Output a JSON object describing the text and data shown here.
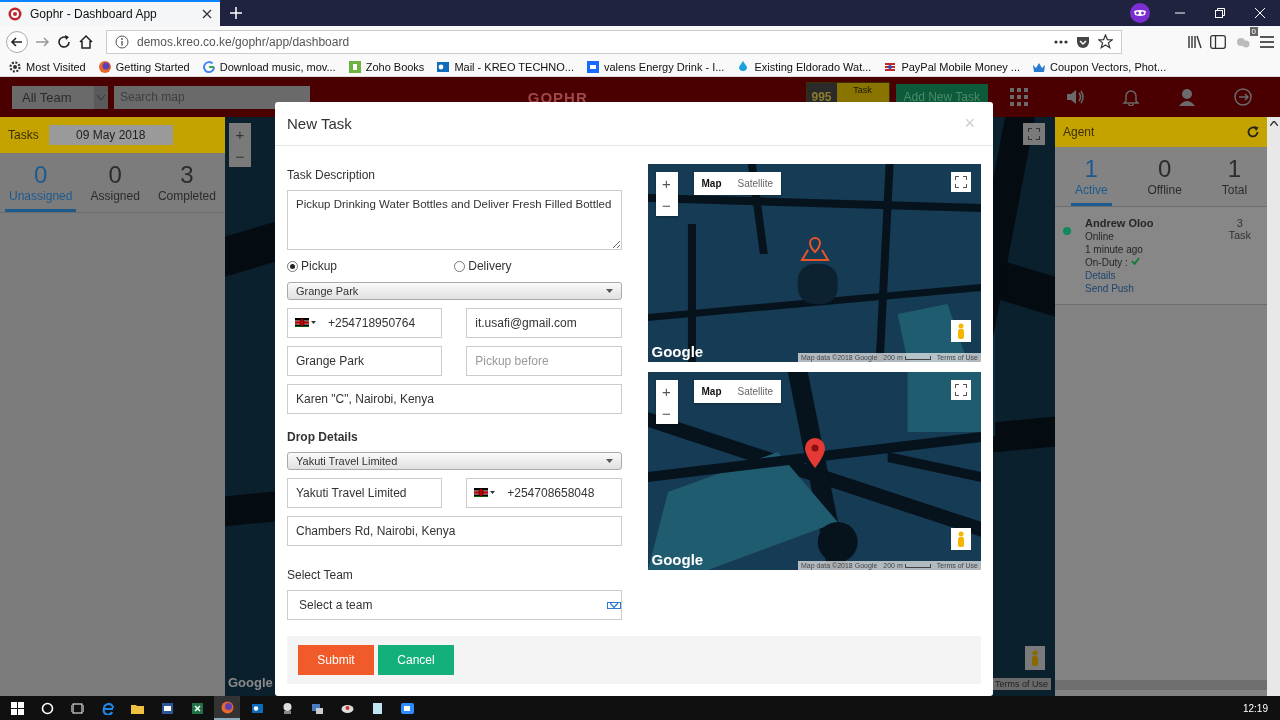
{
  "browser": {
    "tab_title": "Gophr - Dashboard App",
    "url": "demos.kreo.co.ke/gophr/app/dashboard",
    "extension_badge": "0",
    "bookmarks": [
      {
        "label": "Most Visited",
        "kind": "gear"
      },
      {
        "label": "Getting Started",
        "kind": "fox"
      },
      {
        "label": "Download music, mov...",
        "kind": "g"
      },
      {
        "label": "Zoho Books",
        "kind": "zoho"
      },
      {
        "label": "Mail - KREO TECHNO...",
        "kind": "mail"
      },
      {
        "label": "valens Energy Drink - I...",
        "kind": "be"
      },
      {
        "label": "Existing Eldorado Wat...",
        "kind": "drop"
      },
      {
        "label": "PayPal Mobile Money ...",
        "kind": "pay"
      },
      {
        "label": "Coupon Vectors, Phot...",
        "kind": "crown"
      }
    ]
  },
  "header": {
    "team_select": "All Team",
    "search_placeholder": "Search map",
    "logo": "GOPHR",
    "tasks_remaining": "995",
    "tasks_remaining_label": "Task",
    "add_button": "Add New Task"
  },
  "tasks_panel": {
    "title": "Tasks",
    "date": "09 May 2018",
    "tabs": [
      {
        "count": "0",
        "label": "Unassigned",
        "selected": true
      },
      {
        "count": "0",
        "label": "Assigned",
        "selected": false
      },
      {
        "count": "3",
        "label": "Completed",
        "selected": false
      }
    ]
  },
  "background_map": {
    "zoom_in": "+",
    "zoom_out": "−",
    "logo": "Google",
    "terms": "Terms of Use"
  },
  "agent_panel": {
    "title": "Agent",
    "tabs": [
      {
        "count": "1",
        "label": "Active",
        "selected": true
      },
      {
        "count": "0",
        "label": "Offline",
        "selected": false
      },
      {
        "count": "1",
        "label": "Total",
        "selected": false
      }
    ],
    "agents": [
      {
        "name": "Andrew Oloo",
        "status": "Online",
        "last_seen": "1 minute ago",
        "duty_label": "On-Duty :",
        "on_duty": true,
        "links": [
          "Details",
          "Send Push"
        ],
        "task_count": "3",
        "task_label": "Task",
        "color": "#0f8a5a"
      }
    ]
  },
  "modal": {
    "title": "New Task",
    "close": "×",
    "description_label": "Task Description",
    "description": "Pickup Drinking Water Bottles and Deliver Fresh Filled Bottled",
    "task_types": [
      {
        "label": "Pickup",
        "selected": true
      },
      {
        "label": "Delivery",
        "selected": false
      }
    ],
    "pickup_select": "Grange Park",
    "pickup_phone": "+254718950764",
    "pickup_email": "it.usafi@gmail.com",
    "pickup_name": "Grange Park",
    "pickup_before_placeholder": "Pickup before",
    "pickup_address": "Karen \"C\", Nairobi, Kenya",
    "drop_title": "Drop Details",
    "drop_select": "Yakuti Travel Limited",
    "drop_name": "Yakuti Travel Limited",
    "drop_phone": "+254708658048",
    "drop_address": "Chambers Rd, Nairobi, Kenya",
    "team_label": "Select Team",
    "team_select": "Select a team",
    "buttons": [
      {
        "label": "Submit",
        "kind": "submit"
      },
      {
        "label": "Cancel",
        "kind": "cancel"
      }
    ],
    "maps": [
      {
        "kind": "place",
        "zoom_in": "+",
        "zoom_out": "−",
        "map_types": [
          {
            "label": "Map",
            "selected": true
          },
          {
            "label": "Satellite",
            "selected": false
          }
        ],
        "logo": "Google",
        "attribution": "Map data ©2018 Google",
        "scale": "200 m",
        "terms": "Terms of Use"
      },
      {
        "kind": "pin",
        "zoom_in": "+",
        "zoom_out": "−",
        "map_types": [
          {
            "label": "Map",
            "selected": true
          },
          {
            "label": "Satellite",
            "selected": false
          }
        ],
        "logo": "Google",
        "attribution": "Map data ©2018 Google",
        "scale": "200 m",
        "terms": "Terms of Use"
      }
    ]
  },
  "taskbar": {
    "time": "12:19"
  }
}
